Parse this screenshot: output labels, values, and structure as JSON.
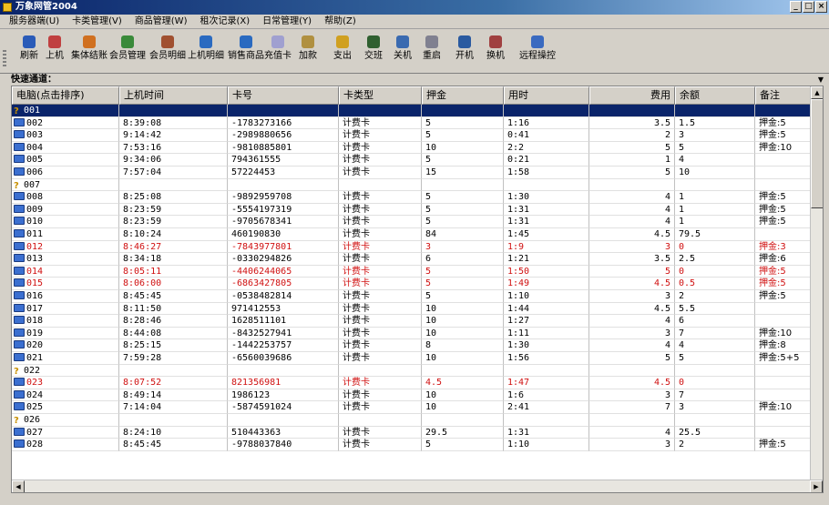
{
  "window": {
    "title": "万象网管2004",
    "controls": [
      "_",
      "□",
      "×"
    ]
  },
  "menu": [
    "服务器端(U)",
    "卡类管理(V)",
    "商品管理(W)",
    "租次记录(X)",
    "日常管理(Y)",
    "帮助(Z)"
  ],
  "toolbar": [
    {
      "label": "刷新",
      "icon": "refresh-icon",
      "color": "#2a5bb8"
    },
    {
      "label": "上机",
      "icon": "logon-icon",
      "color": "#c04040"
    },
    {
      "label": "集体结账",
      "icon": "group-checkout-icon",
      "color": "#d07020"
    },
    {
      "label": "会员管理",
      "icon": "member-manage-icon",
      "color": "#3a8a3a"
    },
    {
      "label": "会员明细",
      "icon": "member-detail-icon",
      "color": "#a05030"
    },
    {
      "label": "上机明细",
      "icon": "logon-detail-icon",
      "color": "#2a6ac0"
    },
    {
      "label": "销售商品",
      "icon": "sell-goods-icon",
      "color": "#2a6ac0"
    },
    {
      "label": "充值卡",
      "icon": "recharge-card-icon",
      "color": "#a0a0d0"
    },
    {
      "label": "加款",
      "icon": "add-money-icon",
      "color": "#b09040"
    },
    {
      "label": "支出",
      "icon": "expense-icon",
      "color": "#d0a020"
    },
    {
      "label": "交班",
      "icon": "shift-change-icon",
      "color": "#306030"
    },
    {
      "label": "关机",
      "icon": "shutdown-icon",
      "color": "#3a6ab0"
    },
    {
      "label": "重启",
      "icon": "restart-icon",
      "color": "#808090"
    },
    {
      "label": "开机",
      "icon": "poweron-icon",
      "color": "#2a5aa0"
    },
    {
      "label": "换机",
      "icon": "switch-machine-icon",
      "color": "#a04040"
    },
    {
      "label": "远程操控",
      "icon": "remote-control-icon",
      "color": "#3a6ac0"
    }
  ],
  "quick_channel": {
    "label": "快速通道："
  },
  "table": {
    "columns": [
      "电脑(点击排序)",
      "上机时间",
      "卡号",
      "卡类型",
      "押金",
      "用时",
      "费用",
      "余额",
      "备注"
    ],
    "rows": [
      {
        "pc": "001",
        "time": "",
        "card": "",
        "type": "",
        "deposit": "",
        "used": "",
        "fee": "",
        "balance": "",
        "note": "",
        "status": "q",
        "selected": true
      },
      {
        "pc": "002",
        "time": "8:39:08",
        "card": "-1783273166",
        "type": "计费卡",
        "deposit": "5",
        "used": "1:16",
        "fee": "3.5",
        "balance": "1.5",
        "note": "押金:5",
        "status": "pc"
      },
      {
        "pc": "003",
        "time": "9:14:42",
        "card": "-2989880656",
        "type": "计费卡",
        "deposit": "5",
        "used": "0:41",
        "fee": "2",
        "balance": "3",
        "note": "押金:5",
        "status": "pc"
      },
      {
        "pc": "004",
        "time": "7:53:16",
        "card": "-9810885801",
        "type": "计费卡",
        "deposit": "10",
        "used": "2:2",
        "fee": "5",
        "balance": "5",
        "note": "押金:10",
        "status": "pc"
      },
      {
        "pc": "005",
        "time": "9:34:06",
        "card": "794361555",
        "type": "计费卡",
        "deposit": "5",
        "used": "0:21",
        "fee": "1",
        "balance": "4",
        "note": "",
        "status": "pc"
      },
      {
        "pc": "006",
        "time": "7:57:04",
        "card": "57224453",
        "type": "计费卡",
        "deposit": "15",
        "used": "1:58",
        "fee": "5",
        "balance": "10",
        "note": "",
        "status": "pc"
      },
      {
        "pc": "007",
        "time": "",
        "card": "",
        "type": "",
        "deposit": "",
        "used": "",
        "fee": "",
        "balance": "",
        "note": "",
        "status": "q"
      },
      {
        "pc": "008",
        "time": "8:25:08",
        "card": "-9892959708",
        "type": "计费卡",
        "deposit": "5",
        "used": "1:30",
        "fee": "4",
        "balance": "1",
        "note": "押金:5",
        "status": "pc"
      },
      {
        "pc": "009",
        "time": "8:23:59",
        "card": "-5554197319",
        "type": "计费卡",
        "deposit": "5",
        "used": "1:31",
        "fee": "4",
        "balance": "1",
        "note": "押金:5",
        "status": "pc"
      },
      {
        "pc": "010",
        "time": "8:23:59",
        "card": "-9705678341",
        "type": "计费卡",
        "deposit": "5",
        "used": "1:31",
        "fee": "4",
        "balance": "1",
        "note": "押金:5",
        "status": "pc"
      },
      {
        "pc": "011",
        "time": "8:10:24",
        "card": "460190830",
        "type": "计费卡",
        "deposit": "84",
        "used": "1:45",
        "fee": "4.5",
        "balance": "79.5",
        "note": "",
        "status": "pc"
      },
      {
        "pc": "012",
        "time": "8:46:27",
        "card": "-7843977801",
        "type": "计费卡",
        "deposit": "3",
        "used": "1:9",
        "fee": "3",
        "balance": "0",
        "note": "押金:3",
        "status": "pc",
        "alert": true
      },
      {
        "pc": "013",
        "time": "8:34:18",
        "card": "-0330294826",
        "type": "计费卡",
        "deposit": "6",
        "used": "1:21",
        "fee": "3.5",
        "balance": "2.5",
        "note": "押金:6",
        "status": "pc"
      },
      {
        "pc": "014",
        "time": "8:05:11",
        "card": "-4406244065",
        "type": "计费卡",
        "deposit": "5",
        "used": "1:50",
        "fee": "5",
        "balance": "0",
        "note": "押金:5",
        "status": "pc",
        "alert": true
      },
      {
        "pc": "015",
        "time": "8:06:00",
        "card": "-6863427805",
        "type": "计费卡",
        "deposit": "5",
        "used": "1:49",
        "fee": "4.5",
        "balance": "0.5",
        "note": "押金:5",
        "status": "pc",
        "alert": true
      },
      {
        "pc": "016",
        "time": "8:45:45",
        "card": "-0538482814",
        "type": "计费卡",
        "deposit": "5",
        "used": "1:10",
        "fee": "3",
        "balance": "2",
        "note": "押金:5",
        "status": "pc"
      },
      {
        "pc": "017",
        "time": "8:11:50",
        "card": "971412553",
        "type": "计费卡",
        "deposit": "10",
        "used": "1:44",
        "fee": "4.5",
        "balance": "5.5",
        "note": "",
        "status": "pc"
      },
      {
        "pc": "018",
        "time": "8:28:46",
        "card": "1628511101",
        "type": "计费卡",
        "deposit": "10",
        "used": "1:27",
        "fee": "4",
        "balance": "6",
        "note": "",
        "status": "pc"
      },
      {
        "pc": "019",
        "time": "8:44:08",
        "card": "-8432527941",
        "type": "计费卡",
        "deposit": "10",
        "used": "1:11",
        "fee": "3",
        "balance": "7",
        "note": "押金:10",
        "status": "pc"
      },
      {
        "pc": "020",
        "time": "8:25:15",
        "card": "-1442253757",
        "type": "计费卡",
        "deposit": "8",
        "used": "1:30",
        "fee": "4",
        "balance": "4",
        "note": "押金:8",
        "status": "pc"
      },
      {
        "pc": "021",
        "time": "7:59:28",
        "card": "-6560039686",
        "type": "计费卡",
        "deposit": "10",
        "used": "1:56",
        "fee": "5",
        "balance": "5",
        "note": "押金:5+5",
        "status": "pc"
      },
      {
        "pc": "022",
        "time": "",
        "card": "",
        "type": "",
        "deposit": "",
        "used": "",
        "fee": "",
        "balance": "",
        "note": "",
        "status": "q"
      },
      {
        "pc": "023",
        "time": "8:07:52",
        "card": "821356981",
        "type": "计费卡",
        "deposit": "4.5",
        "used": "1:47",
        "fee": "4.5",
        "balance": "0",
        "note": "",
        "status": "pc",
        "alert": true
      },
      {
        "pc": "024",
        "time": "8:49:14",
        "card": "1986123",
        "type": "计费卡",
        "deposit": "10",
        "used": "1:6",
        "fee": "3",
        "balance": "7",
        "note": "",
        "status": "pc"
      },
      {
        "pc": "025",
        "time": "7:14:04",
        "card": "-5874591024",
        "type": "计费卡",
        "deposit": "10",
        "used": "2:41",
        "fee": "7",
        "balance": "3",
        "note": "押金:10",
        "status": "pc"
      },
      {
        "pc": "026",
        "time": "",
        "card": "",
        "type": "",
        "deposit": "",
        "used": "",
        "fee": "",
        "balance": "",
        "note": "",
        "status": "q"
      },
      {
        "pc": "027",
        "time": "8:24:10",
        "card": "510443363",
        "type": "计费卡",
        "deposit": "29.5",
        "used": "1:31",
        "fee": "4",
        "balance": "25.5",
        "note": "",
        "status": "pc"
      },
      {
        "pc": "028",
        "time": "8:45:45",
        "card": "-9788037840",
        "type": "计费卡",
        "deposit": "5",
        "used": "1:10",
        "fee": "3",
        "balance": "2",
        "note": "押金:5",
        "status": "pc"
      }
    ]
  },
  "colors": {
    "selected": "#0a246a",
    "alert": "#d01010",
    "pc_icon": "#3b6fd0",
    "idle_icon": "#c89000"
  }
}
